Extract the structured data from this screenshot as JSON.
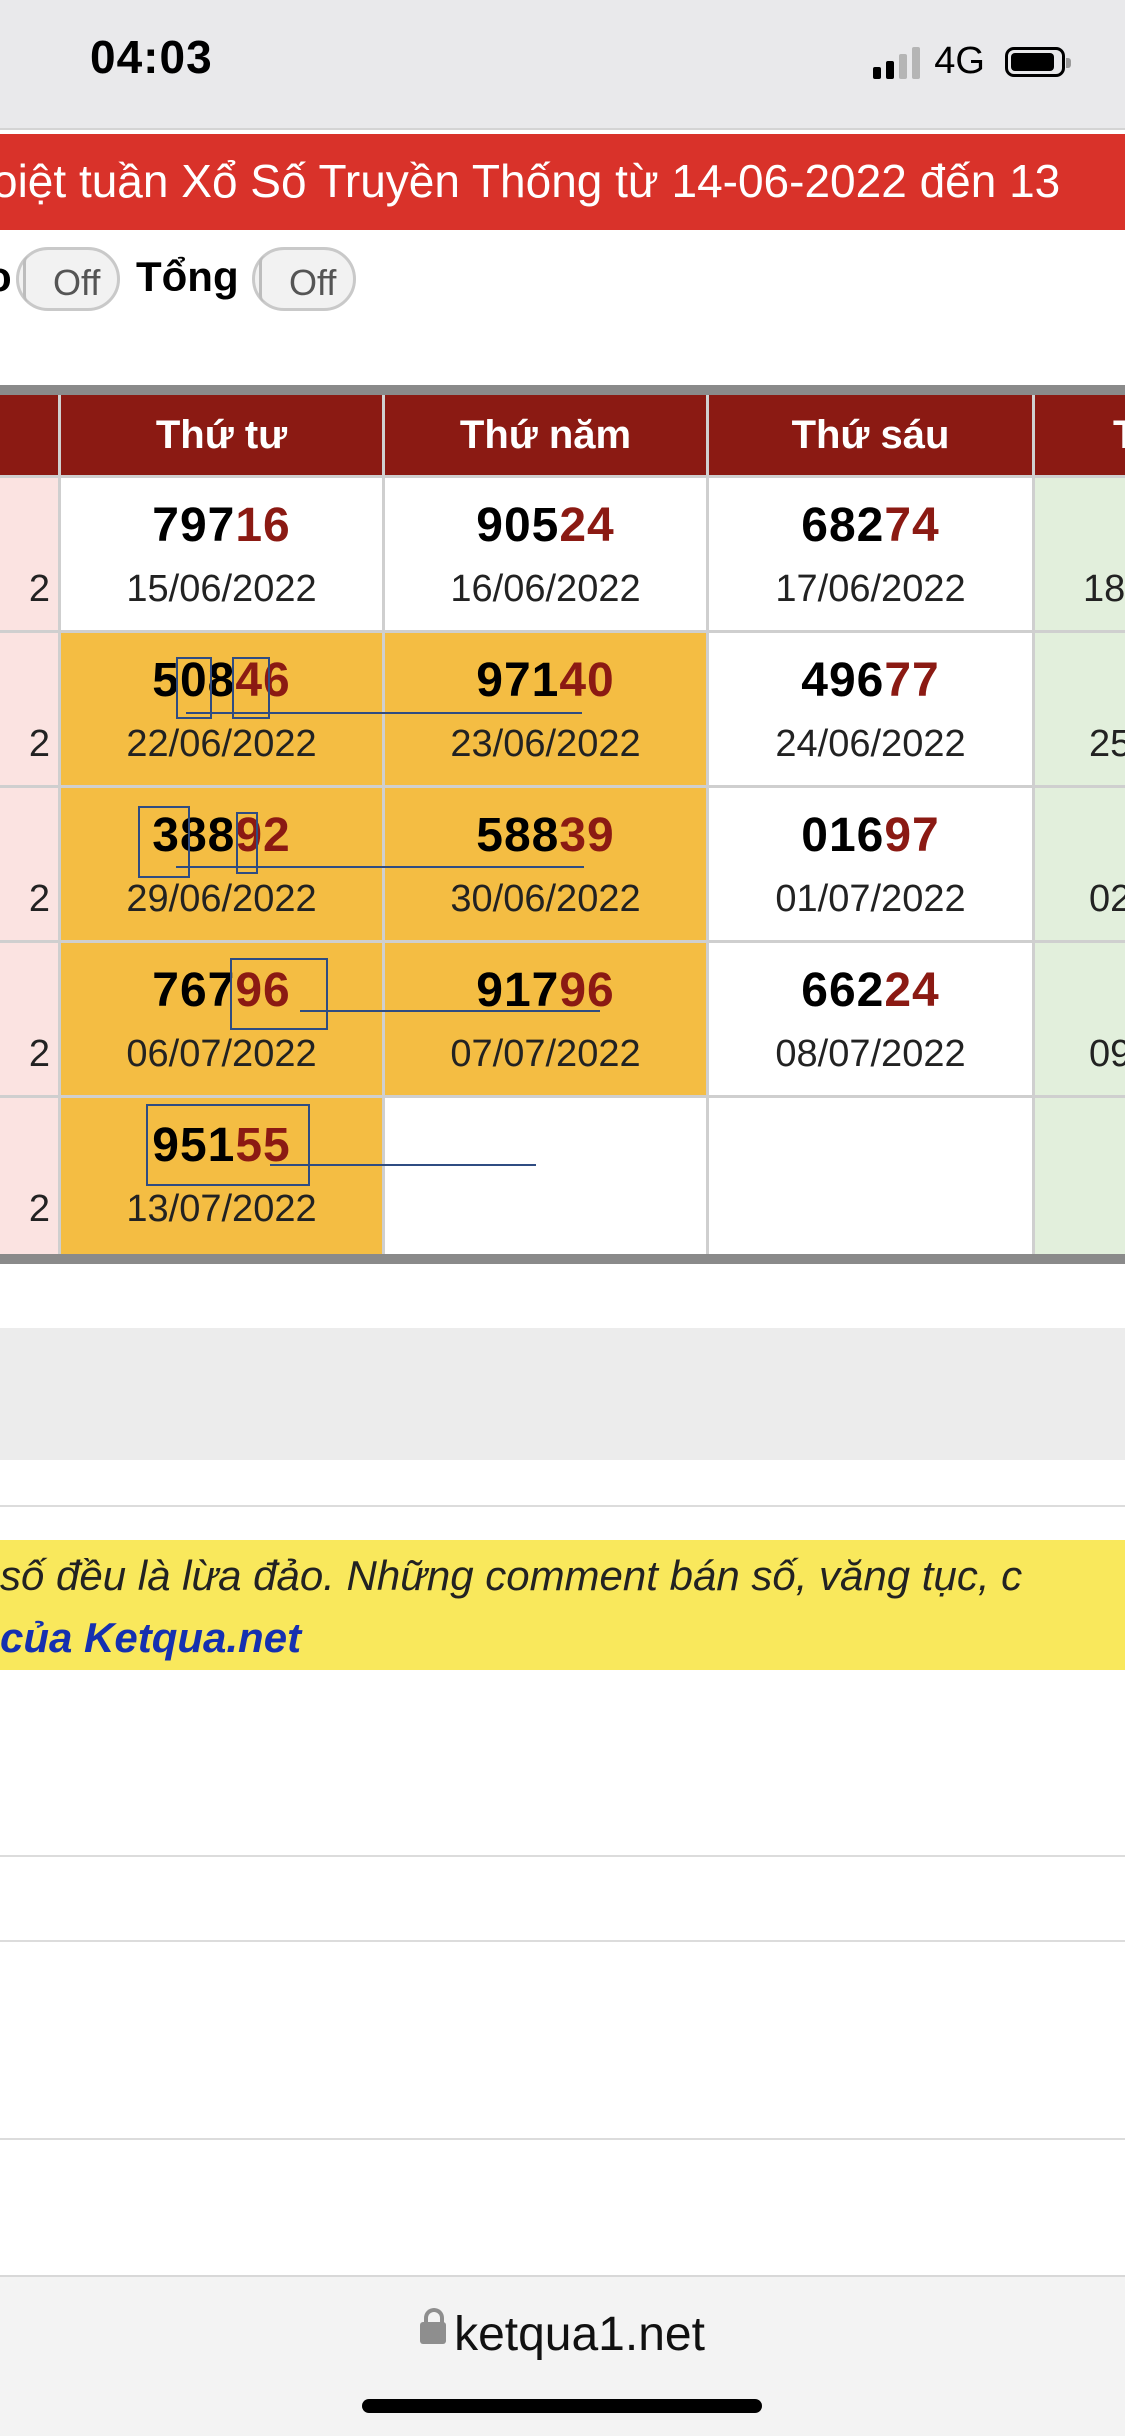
{
  "status_bar": {
    "time": "04:03",
    "network": "4G"
  },
  "banner": {
    "text": "oiệt tuần Xổ Số Truyền Thống từ 14-06-2022 đến 13"
  },
  "toggles": {
    "left_partial": "o",
    "first_state": "Off",
    "second_label": "Tổng",
    "second_state": "Off"
  },
  "table": {
    "headers": [
      "Thứ tư",
      "Thứ năm",
      "Thứ sáu",
      "T"
    ],
    "rows": [
      {
        "left_date_tail": "2",
        "cells": [
          {
            "head": "797",
            "tail": "16",
            "date": "15/06/2022"
          },
          {
            "head": "905",
            "tail": "24",
            "date": "16/06/2022"
          },
          {
            "head": "682",
            "tail": "74",
            "date": "17/06/2022"
          },
          {
            "head": "",
            "tail": "",
            "date": "18"
          }
        ]
      },
      {
        "left_date_tail": "2",
        "cells": [
          {
            "head": "508",
            "tail": "46",
            "date": "22/06/2022"
          },
          {
            "head": "971",
            "tail": "40",
            "date": "23/06/2022"
          },
          {
            "head": "496",
            "tail": "77",
            "date": "24/06/2022"
          },
          {
            "head": "",
            "tail": "",
            "date": "25"
          }
        ]
      },
      {
        "left_date_tail": "2",
        "cells": [
          {
            "head": "388",
            "tail": "92",
            "date": "29/06/2022"
          },
          {
            "head": "588",
            "tail": "39",
            "date": "30/06/2022"
          },
          {
            "head": "016",
            "tail": "97",
            "date": "01/07/2022"
          },
          {
            "head": "",
            "tail": "",
            "date": "02"
          }
        ]
      },
      {
        "left_date_tail": "2",
        "cells": [
          {
            "head": "767",
            "tail": "96",
            "date": "06/07/2022"
          },
          {
            "head": "917",
            "tail": "96",
            "date": "07/07/2022"
          },
          {
            "head": "662",
            "tail": "24",
            "date": "08/07/2022"
          },
          {
            "head": "",
            "tail": "",
            "date": "09"
          }
        ]
      },
      {
        "left_date_tail": "2",
        "cells": [
          {
            "head": "951",
            "tail": "55",
            "date": "13/07/2022"
          },
          {
            "head": "",
            "tail": "",
            "date": ""
          },
          {
            "head": "",
            "tail": "",
            "date": ""
          },
          {
            "head": "",
            "tail": "",
            "date": ""
          }
        ]
      }
    ]
  },
  "warning": {
    "line1": "số đều là lừa đảo. Những comment bán số, văng tục, c",
    "line2": "của Ketqua.net"
  },
  "browser": {
    "url": "ketqua1.net"
  }
}
